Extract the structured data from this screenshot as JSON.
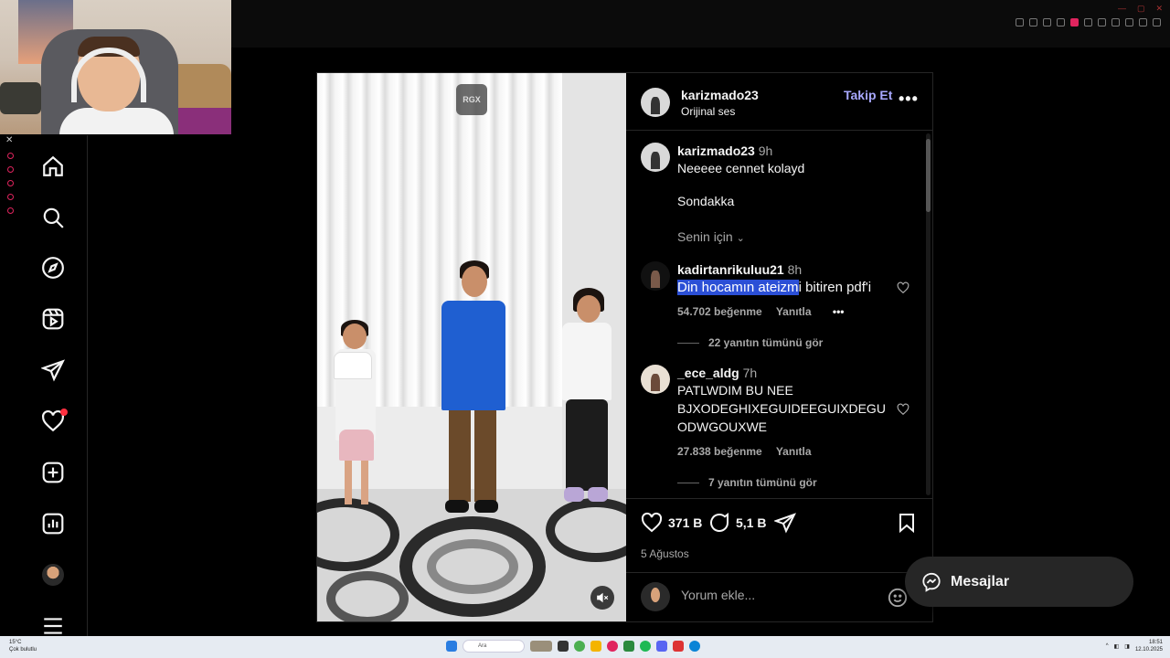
{
  "post": {
    "author": "karizmado23",
    "audio": "Orijinal ses",
    "follow_label": "Takip Et",
    "media_watermark": "RGX",
    "caption": {
      "username": "karizmado23",
      "time": "9h",
      "line1": "Neeeee cennet kolayd",
      "line2": "Sondakka",
      "for_you": "Senin için"
    },
    "comments": [
      {
        "username": "kadirtanrikuluu21",
        "time": "8h",
        "text_selected": "Din hocamın ateizm",
        "text_rest": "i bitiren pdf'i",
        "likes": "54.702 beğenme",
        "reply": "Yanıtla",
        "view_replies": "22 yanıtın tümünü gör"
      },
      {
        "username": "_ece_aldg",
        "time": "7h",
        "text_l1": "PATLWDIM BU NEE",
        "text_l2": "BJXODEGHIXEGUIDEEGUIXDEGU",
        "text_l3": "ODWGOUXWE",
        "likes": "27.838 beğenme",
        "reply": "Yanıtla",
        "view_replies": "7 yanıtın tümünü gör"
      }
    ],
    "like_count": "371 B",
    "comment_count": "5,1 B",
    "date": "5 Ağustos",
    "comment_placeholder": "Yorum ekle..."
  },
  "messages_label": "Mesajlar",
  "taskbar": {
    "temp": "15°C",
    "weather": "Çok bulutlu",
    "search": "Ara",
    "time": "18:51",
    "date": "12.10.2025"
  },
  "colors": {
    "accent_follow": "#a8a8ff",
    "notification": "#ff3040",
    "selection": "#2b4fd6",
    "background": "#000000"
  },
  "icons": [
    "home-icon",
    "search-icon",
    "explore-icon",
    "reels-icon",
    "send-icon",
    "heart-icon",
    "create-icon",
    "dashboard-icon",
    "menu-icon",
    "messenger-icon"
  ]
}
